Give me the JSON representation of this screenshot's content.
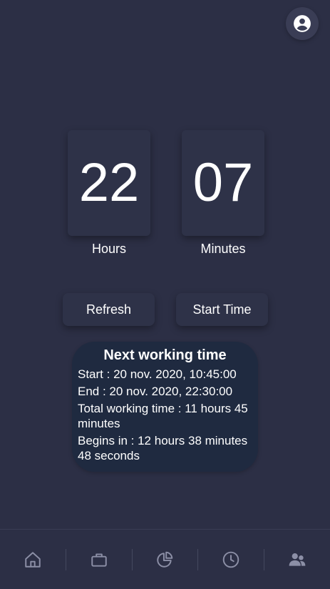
{
  "header": {
    "profile_icon": "account-circle-icon"
  },
  "timer": {
    "hours_value": "22",
    "hours_label": "Hours",
    "minutes_value": "07",
    "minutes_label": "Minutes"
  },
  "actions": {
    "refresh_label": "Refresh",
    "start_time_label": "Start Time"
  },
  "next_working": {
    "title": "Next working time",
    "start": "Start : 20 nov. 2020, 10:45:00",
    "end": "End : 20 nov. 2020, 22:30:00",
    "total": "Total working time : 11 hours 45 minutes",
    "begins_in": "Begins in : 12 hours 38 minutes 48 seconds"
  },
  "nav": {
    "items": [
      {
        "icon": "home-icon"
      },
      {
        "icon": "briefcase-icon"
      },
      {
        "icon": "pie-chart-icon"
      },
      {
        "icon": "clock-icon"
      },
      {
        "icon": "users-icon"
      }
    ]
  },
  "colors": {
    "background": "#2c2f45",
    "card": "#1f2a40",
    "box": "#2e3248",
    "icon_muted": "#8c8fa6"
  }
}
